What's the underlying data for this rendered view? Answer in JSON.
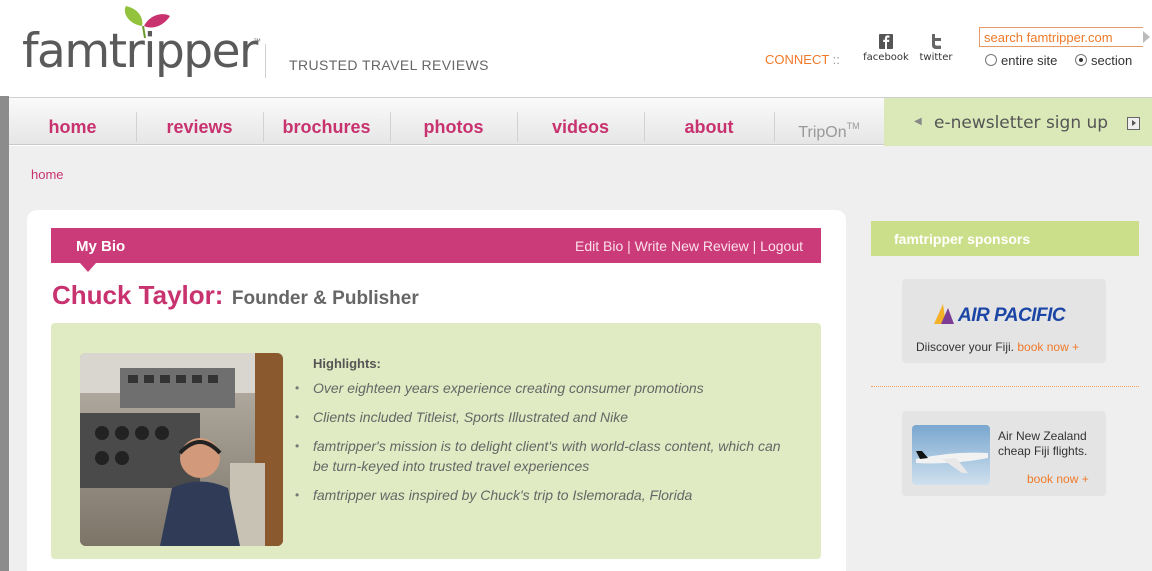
{
  "header": {
    "logo_text": "famtripper",
    "logo_tm": "™",
    "tagline": "TRUSTED TRAVEL REVIEWS",
    "connect_label": "CONNECT",
    "connect_sep": "::",
    "social": [
      {
        "label": "facebook",
        "icon": "facebook-icon"
      },
      {
        "label": "twitter",
        "icon": "twitter-icon"
      }
    ],
    "search_value": "search famtripper.com",
    "search_scope": [
      {
        "label": "entire site",
        "selected": false
      },
      {
        "label": "section",
        "selected": true
      }
    ]
  },
  "nav": {
    "items": [
      "home",
      "reviews",
      "brochures",
      "photos",
      "videos",
      "about"
    ],
    "tripon": "TripOn",
    "tripon_tm": "TM",
    "newsletter": "e-newsletter sign up"
  },
  "breadcrumb": "home",
  "bio": {
    "bar_title": "My Bio",
    "actions": "Edit Bio | Write New Review | Logout",
    "name": "Chuck Taylor:",
    "role": "Founder & Publisher",
    "highlights_title": "Highlights:",
    "highlights": [
      "Over eighteen years experience creating consumer promotions",
      "Clients included Titleist, Sports Illustrated and Nike",
      "famtripper's mission is to delight client's with world-class content, which can be turn-keyed into trusted travel experiences",
      "famtripper was inspired by Chuck's trip to Islemorada, Florida"
    ]
  },
  "sidebar": {
    "title": "famtripper sponsors",
    "ads": [
      {
        "brand": "AIR PACIFIC",
        "text": "Diiscover your Fiji.",
        "link": "book now +"
      },
      {
        "text_line1": "Air New Zealand",
        "text_line2": "cheap Fiji flights.",
        "link": "book now +"
      }
    ]
  },
  "colors": {
    "brand_pink": "#cc3b79",
    "accent_orange": "#f07a2a",
    "green_light": "#e0ebc3",
    "green_bar": "#cbdf8a"
  }
}
